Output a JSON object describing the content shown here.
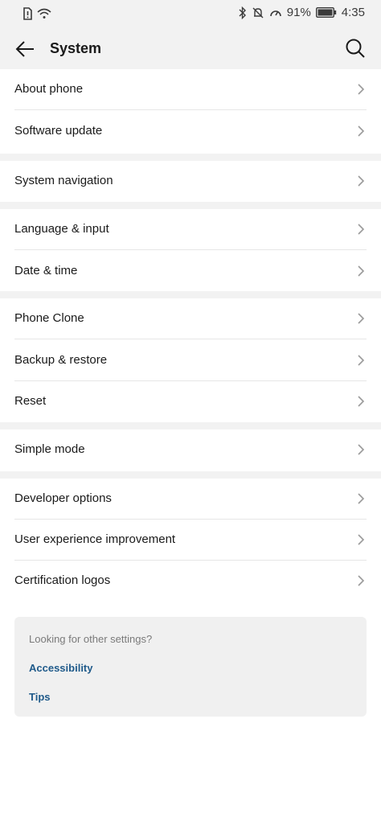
{
  "status_bar": {
    "battery": "91%",
    "time": "4:35"
  },
  "app_bar": {
    "title": "System"
  },
  "sections": [
    {
      "items": [
        "About phone",
        "Software update"
      ]
    },
    {
      "items": [
        "System navigation"
      ]
    },
    {
      "items": [
        "Language & input",
        "Date & time"
      ]
    },
    {
      "items": [
        "Phone Clone",
        "Backup & restore",
        "Reset"
      ]
    },
    {
      "items": [
        "Simple mode"
      ]
    },
    {
      "items": [
        "Developer options",
        "User experience improvement",
        "Certification logos"
      ]
    }
  ],
  "help_card": {
    "prompt": "Looking for other settings?",
    "link1": "Accessibility",
    "link2": "Tips"
  },
  "colors": {
    "background": "#ffffff",
    "section_gap": "#f2f2f2",
    "link": "#1f5a8a"
  }
}
